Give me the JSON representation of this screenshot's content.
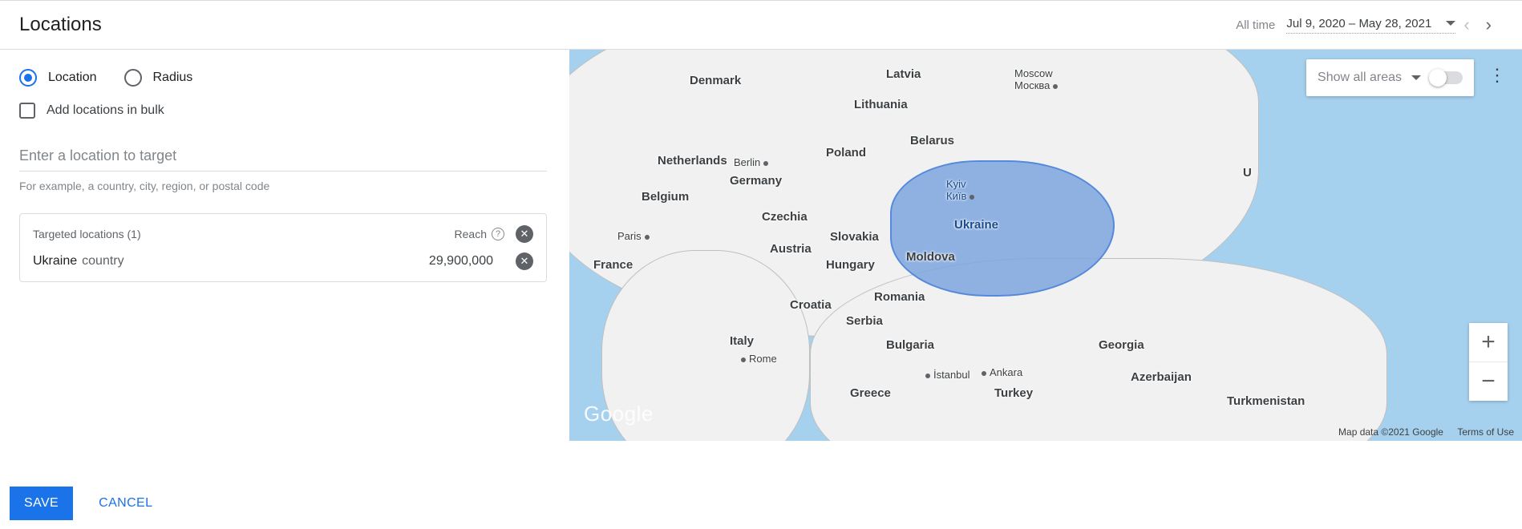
{
  "header": {
    "title": "Locations",
    "date_label": "All time",
    "date_range": "Jul 9, 2020 – May 28, 2021"
  },
  "left": {
    "radio_location": "Location",
    "radio_radius": "Radius",
    "bulk_label": "Add locations in bulk",
    "input_placeholder": "Enter a location to target",
    "hint": "For example, a country, city, region, or postal code",
    "targets_header": "Targeted locations (1)",
    "reach_label": "Reach",
    "targets": [
      {
        "name": "Ukraine",
        "type": "country",
        "reach": "29,900,000"
      }
    ]
  },
  "map": {
    "show_areas": "Show all areas",
    "logo": "Google",
    "attribution": "Map data ©2021 Google",
    "terms": "Terms of Use",
    "labels": {
      "denmark": "Denmark",
      "netherlands": "Netherlands",
      "belgium": "Belgium",
      "germany": "Germany",
      "berlin": "Berlin",
      "poland": "Poland",
      "latvia": "Latvia",
      "lithuania": "Lithuania",
      "belarus": "Belarus",
      "moscow": "Moscow",
      "moscow_ru": "Москва",
      "czechia": "Czechia",
      "slovakia": "Slovakia",
      "austria": "Austria",
      "hungary": "Hungary",
      "moldova": "Moldova",
      "ukraine": "Ukraine",
      "kyiv": "Kyiv",
      "kyiv_ua": "Київ",
      "romania": "Romania",
      "france": "France",
      "paris": "Paris",
      "italy": "Italy",
      "rome": "Rome",
      "croatia": "Croatia",
      "serbia": "Serbia",
      "bulgaria": "Bulgaria",
      "greece": "Greece",
      "turkey": "Turkey",
      "istanbul": "İstanbul",
      "ankara": "Ankara",
      "georgia": "Georgia",
      "azerbaijan": "Azerbaijan",
      "turkmenistan": "Turkmenistan",
      "u_": "U"
    }
  },
  "footer": {
    "save": "SAVE",
    "cancel": "CANCEL"
  }
}
